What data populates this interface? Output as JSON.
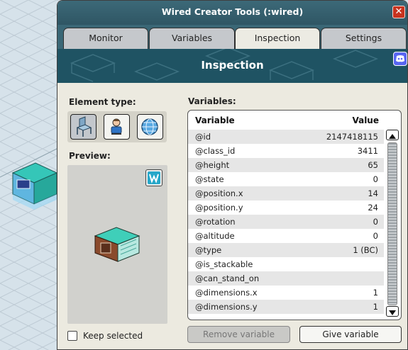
{
  "window": {
    "title": "Wired Creator Tools (:wired)",
    "close_glyph": "✕"
  },
  "tabs": [
    {
      "label": "Monitor"
    },
    {
      "label": "Variables"
    },
    {
      "label": "Inspection",
      "active": true
    },
    {
      "label": "Settings"
    }
  ],
  "banner": {
    "heading": "Inspection"
  },
  "element_type": {
    "label": "Element type:",
    "options": [
      {
        "icon": "chair-furni-icon",
        "active": true
      },
      {
        "icon": "user-avatar-icon",
        "active": false
      },
      {
        "icon": "globe-room-icon",
        "active": false
      }
    ]
  },
  "preview": {
    "label": "Preview:"
  },
  "keep_selected": {
    "label": "Keep selected",
    "checked": false
  },
  "variables": {
    "label": "Variables:",
    "columns": {
      "variable": "Variable",
      "value": "Value"
    },
    "rows": [
      {
        "name": "@id",
        "value": "2147418115"
      },
      {
        "name": "@class_id",
        "value": "3411"
      },
      {
        "name": "@height",
        "value": "65"
      },
      {
        "name": "@state",
        "value": "0"
      },
      {
        "name": "@position.x",
        "value": "14"
      },
      {
        "name": "@position.y",
        "value": "24"
      },
      {
        "name": "@rotation",
        "value": "0"
      },
      {
        "name": "@altitude",
        "value": "0"
      },
      {
        "name": "@type",
        "value": "1 (BC)"
      },
      {
        "name": "@is_stackable",
        "value": ""
      },
      {
        "name": "@can_stand_on",
        "value": ""
      },
      {
        "name": "@dimensions.x",
        "value": "1"
      },
      {
        "name": "@dimensions.y",
        "value": "1"
      }
    ]
  },
  "buttons": {
    "remove": "Remove variable",
    "give": "Give variable"
  }
}
